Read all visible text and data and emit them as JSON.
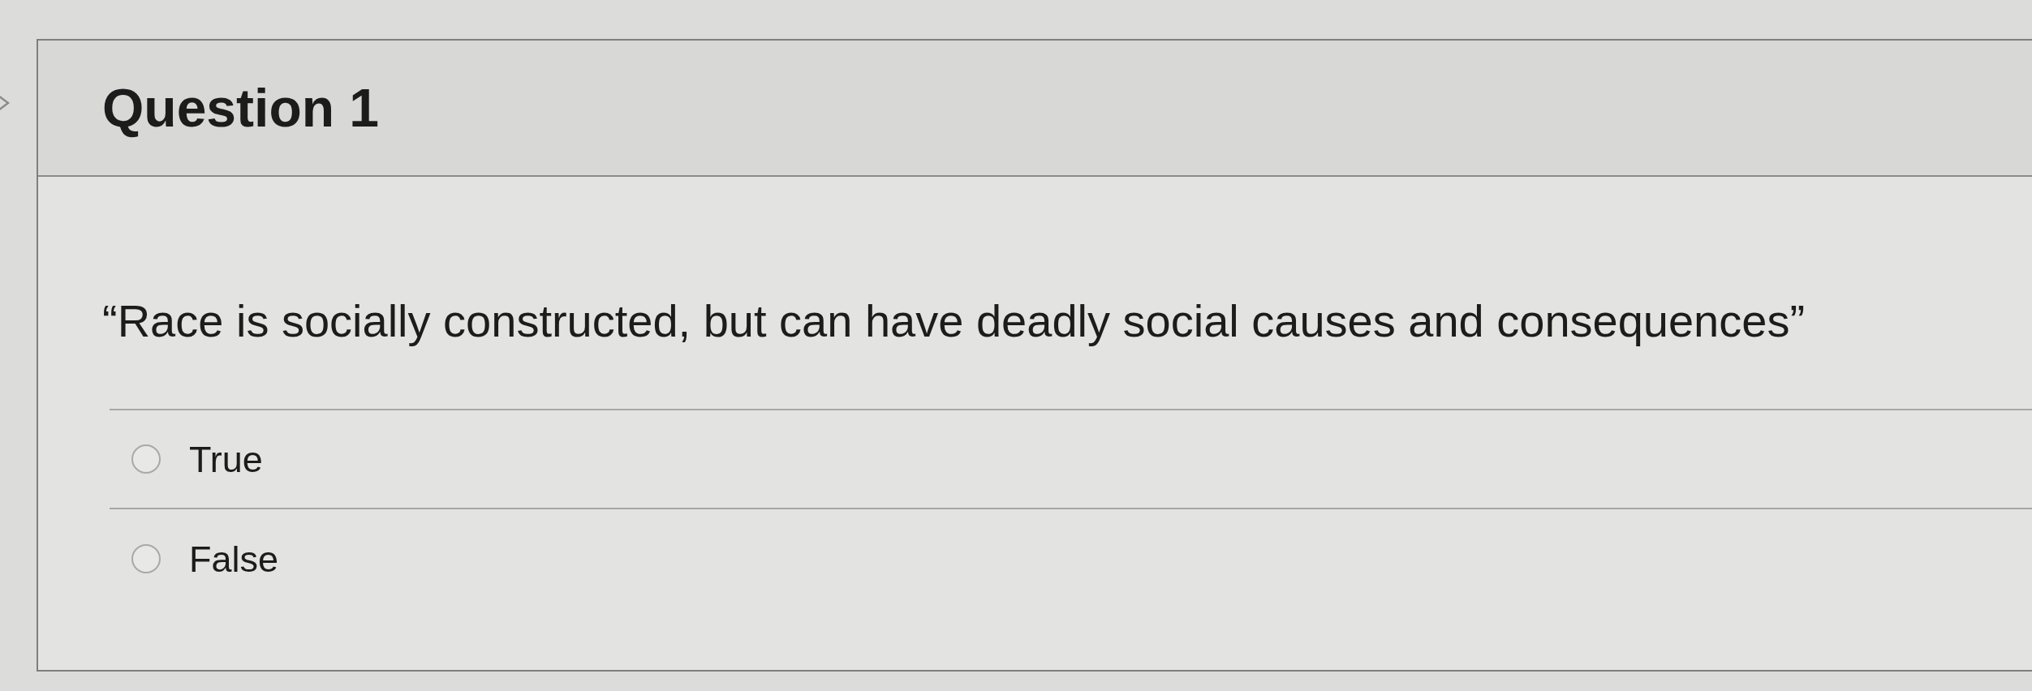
{
  "question": {
    "title": "Question 1",
    "text": "“Race is socially constructed, but can have deadly social causes and consequences”",
    "options": [
      {
        "label": "True",
        "selected": false
      },
      {
        "label": "False",
        "selected": false
      }
    ]
  }
}
